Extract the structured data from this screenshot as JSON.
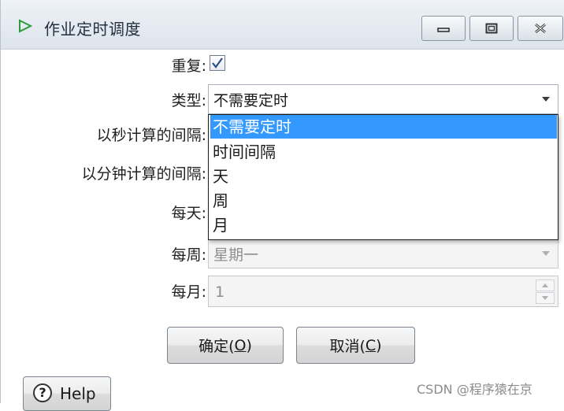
{
  "window": {
    "title": "作业定时调度",
    "buttons": {
      "minimize": "minimize",
      "maximize": "maximize",
      "close": "close"
    }
  },
  "form": {
    "repeat_label": "重复:",
    "repeat_checked": true,
    "type_label": "类型:",
    "type_value": "不需要定时",
    "seconds_label": "以秒计算的间隔:",
    "minutes_label": "以分钟计算的间隔:",
    "daily_label": "每天:",
    "weekly_label": "每周:",
    "weekly_value": "星期一",
    "monthly_label": "每月:",
    "monthly_value": "1"
  },
  "dropdown": {
    "options": [
      "不需要定时",
      "时间间隔",
      "天",
      "周",
      "月"
    ],
    "selected_index": 0
  },
  "buttons": {
    "ok_label": "确定(",
    "ok_key": "O",
    "ok_suffix": ")",
    "cancel_label": "取消(",
    "cancel_key": "C",
    "cancel_suffix": ")",
    "help_label": "Help",
    "help_icon": "?"
  },
  "watermark": "CSDN @程序猿在京",
  "colors": {
    "selection": "#3399ff",
    "title_icon": "#2a9d3a",
    "checkmark": "#2b4f8c"
  }
}
